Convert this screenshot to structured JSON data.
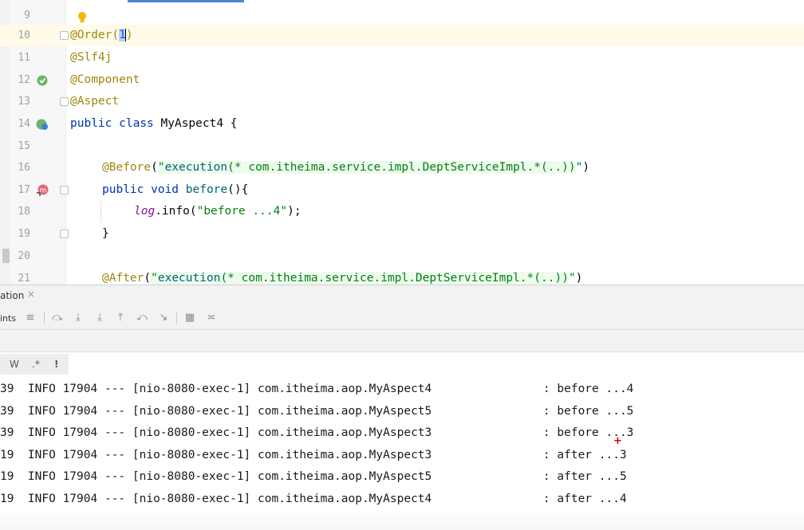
{
  "editor": {
    "lines": [
      {
        "num": "9"
      },
      {
        "num": "10",
        "t1": "@Order(",
        "t2": "1",
        "t3": ")"
      },
      {
        "num": "11",
        "t1": "@Slf4j"
      },
      {
        "num": "12",
        "t1": "@Component"
      },
      {
        "num": "13",
        "t1": "@Aspect"
      },
      {
        "num": "14",
        "kw": "public class ",
        "t1": "MyAspect4 {"
      },
      {
        "num": "15"
      },
      {
        "num": "16",
        "ann": "@Before",
        "p1": "(",
        "q1": "\"",
        "fn": "execution",
        "q2": "(* com.itheima.service.impl.DeptServiceImpl.*(..))",
        "q3": "\"",
        "p2": ")"
      },
      {
        "num": "17",
        "kw": "public void ",
        "fn": "before",
        "t1": "(){"
      },
      {
        "num": "18",
        "field": "log",
        "t1": ".info(",
        "str": "\"before ...4\"",
        "t2": ");"
      },
      {
        "num": "19",
        "t1": "}"
      },
      {
        "num": "20"
      },
      {
        "num": "21",
        "ann": "@After",
        "p1": "(",
        "q1": "\"",
        "fn": "execution",
        "q2": "(* com.itheima.service.impl.DeptServiceImpl.*(..))",
        "q3": "\"",
        "p2": ")"
      }
    ]
  },
  "tool_window": {
    "title": "ation",
    "toolbar_label": "ints",
    "filter": {
      "words": "W",
      "regex": ".*",
      "mark": "!"
    }
  },
  "console": {
    "lines": [
      {
        "prefix": "39",
        "msg": "  INFO 17904 --- [nio-8080-exec-1] com.itheima.aop.MyAspect4                : before ...4"
      },
      {
        "prefix": "39",
        "msg": "  INFO 17904 --- [nio-8080-exec-1] com.itheima.aop.MyAspect5                : before ...5"
      },
      {
        "prefix": "39",
        "msg": "  INFO 17904 --- [nio-8080-exec-1] com.itheima.aop.MyAspect3                : before ...3"
      },
      {
        "prefix": "19",
        "msg": "  INFO 17904 --- [nio-8080-exec-1] com.itheima.aop.MyAspect3                : after ...3"
      },
      {
        "prefix": "19",
        "msg": "  INFO 17904 --- [nio-8080-exec-1] com.itheima.aop.MyAspect5                : after ...5"
      },
      {
        "prefix": "19",
        "msg": "  INFO 17904 --- [nio-8080-exec-1] com.itheima.aop.MyAspect4                : after ...4"
      }
    ]
  },
  "colors": {
    "accent": "#4a86c8",
    "annotation": "#9e880d",
    "keyword": "#0033b3",
    "string": "#067d17"
  }
}
